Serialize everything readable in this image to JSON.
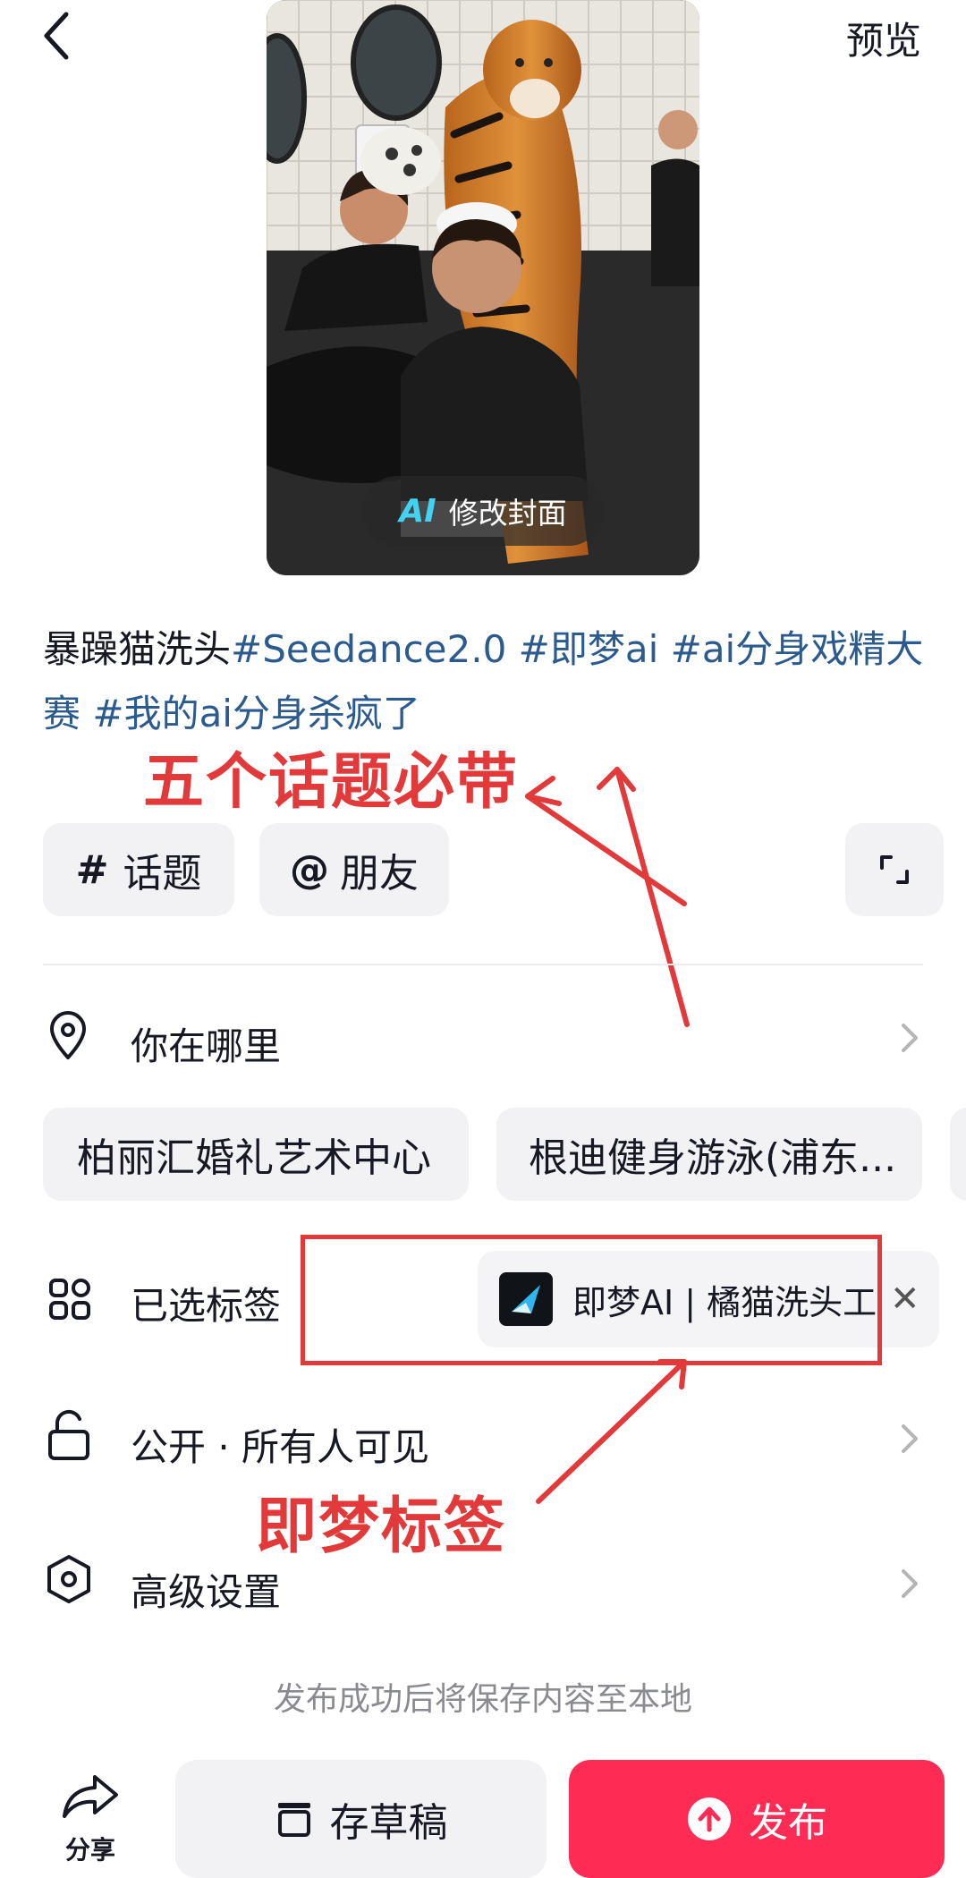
{
  "header": {
    "preview_label": "预览"
  },
  "cover": {
    "ai_badge": "AI",
    "edit_label": "修改封面"
  },
  "caption": {
    "prefix": "暴躁猫洗头",
    "topics": [
      "#Seedance2.0",
      "#即梦ai",
      "#ai分身戏精大赛",
      "#我的ai分身杀疯了"
    ]
  },
  "annotations": {
    "topics_note": "五个话题必带",
    "tag_note": "即梦标签",
    "color": "#e23a3a"
  },
  "actions": {
    "topic_label": "话题",
    "topic_symbol": "#",
    "friend_label": "朋友",
    "friend_symbol": "@"
  },
  "location": {
    "label": "你在哪里",
    "suggestions": [
      "柏丽汇婚礼艺术中心",
      "根迪健身游泳(浦东..."
    ]
  },
  "tags": {
    "label": "已选标签",
    "selected": "即梦AI | 橘猫洗头工",
    "close_symbol": "✕"
  },
  "privacy": {
    "label": "公开 · 所有人可见"
  },
  "advanced": {
    "label": "高级设置"
  },
  "note": "发布成功后将保存内容至本地",
  "bottom": {
    "share_label": "分享",
    "draft_label": "存草稿",
    "publish_label": "发布",
    "publish_color": "#fe2c55"
  }
}
